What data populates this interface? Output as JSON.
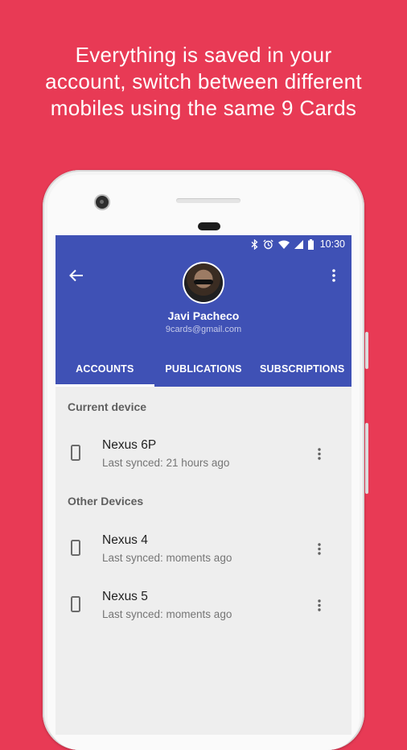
{
  "headline": {
    "line1": "Everything is saved in your",
    "line2": "account, switch between different",
    "line3": "mobiles using the same 9 Cards"
  },
  "status_bar": {
    "time": "10:30",
    "icons": [
      "bluetooth-icon",
      "alarm-icon",
      "wifi-icon",
      "signal-icon",
      "battery-icon"
    ]
  },
  "profile": {
    "name": "Javi Pacheco",
    "email": "9cards@gmail.com"
  },
  "tabs": [
    {
      "label": "ACCOUNTS",
      "active": true
    },
    {
      "label": "PUBLICATIONS",
      "active": false
    },
    {
      "label": "SUBSCRIPTIONS",
      "active": false
    }
  ],
  "sections": {
    "current": {
      "title": "Current device",
      "devices": [
        {
          "name": "Nexus 6P",
          "sync": "Last synced: 21 hours ago"
        }
      ]
    },
    "other": {
      "title": "Other Devices",
      "devices": [
        {
          "name": "Nexus 4",
          "sync": "Last synced: moments ago"
        },
        {
          "name": "Nexus 5",
          "sync": "Last synced: moments ago"
        }
      ]
    }
  },
  "colors": {
    "background": "#e83a55",
    "app_bar": "#3f51b5",
    "screen_bg": "#eeeeee"
  }
}
